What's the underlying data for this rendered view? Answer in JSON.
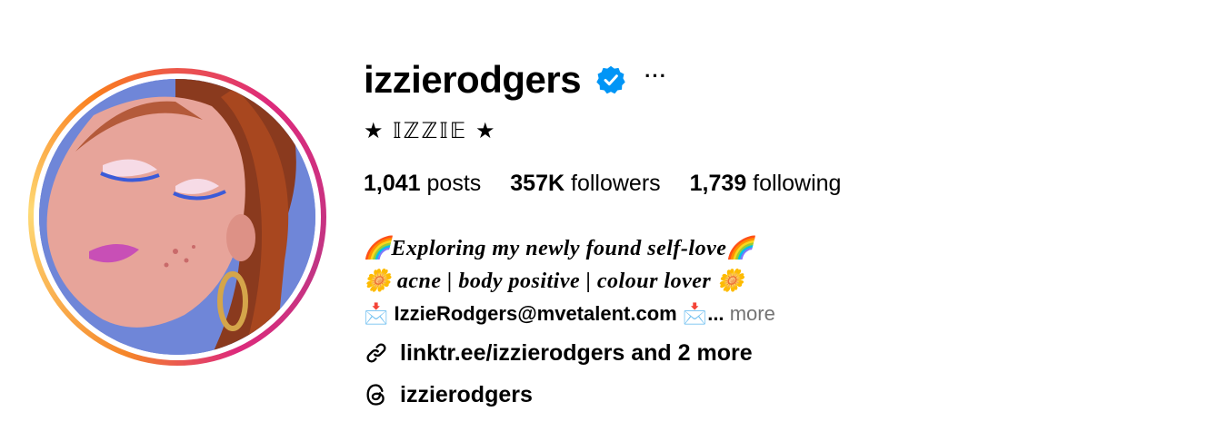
{
  "profile": {
    "username": "izzierodgers",
    "display_name": "★ 𝕀ℤℤ𝕀𝔼 ★",
    "more_options": "···",
    "verified": true
  },
  "stats": {
    "posts_count": "1,041",
    "posts_label": "posts",
    "followers_count": "357K",
    "followers_label": "followers",
    "following_count": "1,739",
    "following_label": "following"
  },
  "bio": {
    "line1": "🌈Exploring my newly found self-love🌈",
    "line2": "🌼 acne | body positive | colour lover 🌼",
    "line3": "📩 IzzieRodgers@mvetalent.com 📩...",
    "more_label": "more"
  },
  "links": {
    "external": "linktr.ee/izzierodgers and 2 more",
    "threads": "izzierodgers"
  },
  "icons": {
    "verified": "verified-badge-icon",
    "link": "link-icon",
    "threads": "threads-icon"
  },
  "colors": {
    "verified_blue": "#0095f6",
    "muted_text": "#737373"
  }
}
